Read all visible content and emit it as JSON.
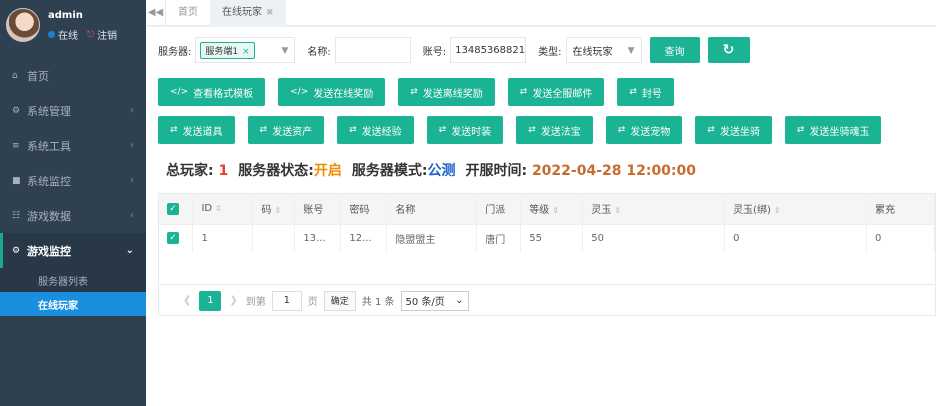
{
  "user": {
    "name": "admin",
    "status": "在线",
    "logout": "注销"
  },
  "sidebar": {
    "items": [
      {
        "label": "首页",
        "icon": "home-icon"
      },
      {
        "label": "系统管理",
        "icon": "gear-icon"
      },
      {
        "label": "系统工具",
        "icon": "list-icon"
      },
      {
        "label": "系统监控",
        "icon": "video-icon"
      },
      {
        "label": "游戏数据",
        "icon": "sitemap-icon"
      },
      {
        "label": "游戏监控",
        "icon": "gear-icon"
      }
    ],
    "sub_items": [
      {
        "label": "服务器列表"
      },
      {
        "label": "在线玩家"
      }
    ]
  },
  "tabs": [
    {
      "label": "首页"
    },
    {
      "label": "在线玩家"
    }
  ],
  "filters": {
    "server_label": "服务器:",
    "server_tag": "服务端1",
    "name_label": "名称:",
    "name_value": "",
    "account_label": "账号:",
    "account_value": "13485368821",
    "type_label": "类型:",
    "type_value": "在线玩家",
    "query_label": "查询",
    "refresh_icon": "refresh-icon"
  },
  "actions_row1": [
    {
      "label": "查看格式模板",
      "icon": "code-icon"
    },
    {
      "label": "发送在线奖励",
      "icon": "code-icon"
    },
    {
      "label": "发送离线奖励",
      "icon": "random-icon"
    },
    {
      "label": "发送全服邮件",
      "icon": "random-icon"
    },
    {
      "label": "封号",
      "icon": "random-icon"
    }
  ],
  "actions_row2": [
    {
      "label": "发送道具",
      "icon": "random-icon"
    },
    {
      "label": "发送资产",
      "icon": "random-icon"
    },
    {
      "label": "发送经验",
      "icon": "random-icon"
    },
    {
      "label": "发送时装",
      "icon": "random-icon"
    },
    {
      "label": "发送法宝",
      "icon": "random-icon"
    },
    {
      "label": "发送宠物",
      "icon": "random-icon"
    },
    {
      "label": "发送坐骑",
      "icon": "random-icon"
    },
    {
      "label": "发送坐骑魂玉",
      "icon": "random-icon"
    }
  ],
  "summary": {
    "players_label": "总玩家:",
    "players_value": "1",
    "status_label": "服务器状态:",
    "status_value": "开启",
    "mode_label": "服务器模式:",
    "mode_value": "公测",
    "open_label": "开服时间:",
    "open_value": "2022-04-28 12:00:00"
  },
  "table": {
    "columns": [
      "ID",
      "码",
      "账号",
      "密码",
      "名称",
      "门派",
      "等级",
      "灵玉",
      "灵玉(绑)",
      "累充"
    ],
    "rows": [
      [
        "1",
        "",
        "13...",
        "12...",
        "隐盟盟主",
        "唐门",
        "55",
        "50",
        "0",
        "0"
      ]
    ]
  },
  "pager": {
    "current_page": "1",
    "goto_label": "到第",
    "goto_value": "1",
    "page_unit": "页",
    "confirm_label": "确定",
    "total_label": "共 1 条",
    "page_size": "50 条/页"
  },
  "colors": {
    "accent": "#1ab394",
    "sidebar_bg": "#2f4050",
    "active_item": "#1a8fe0"
  }
}
